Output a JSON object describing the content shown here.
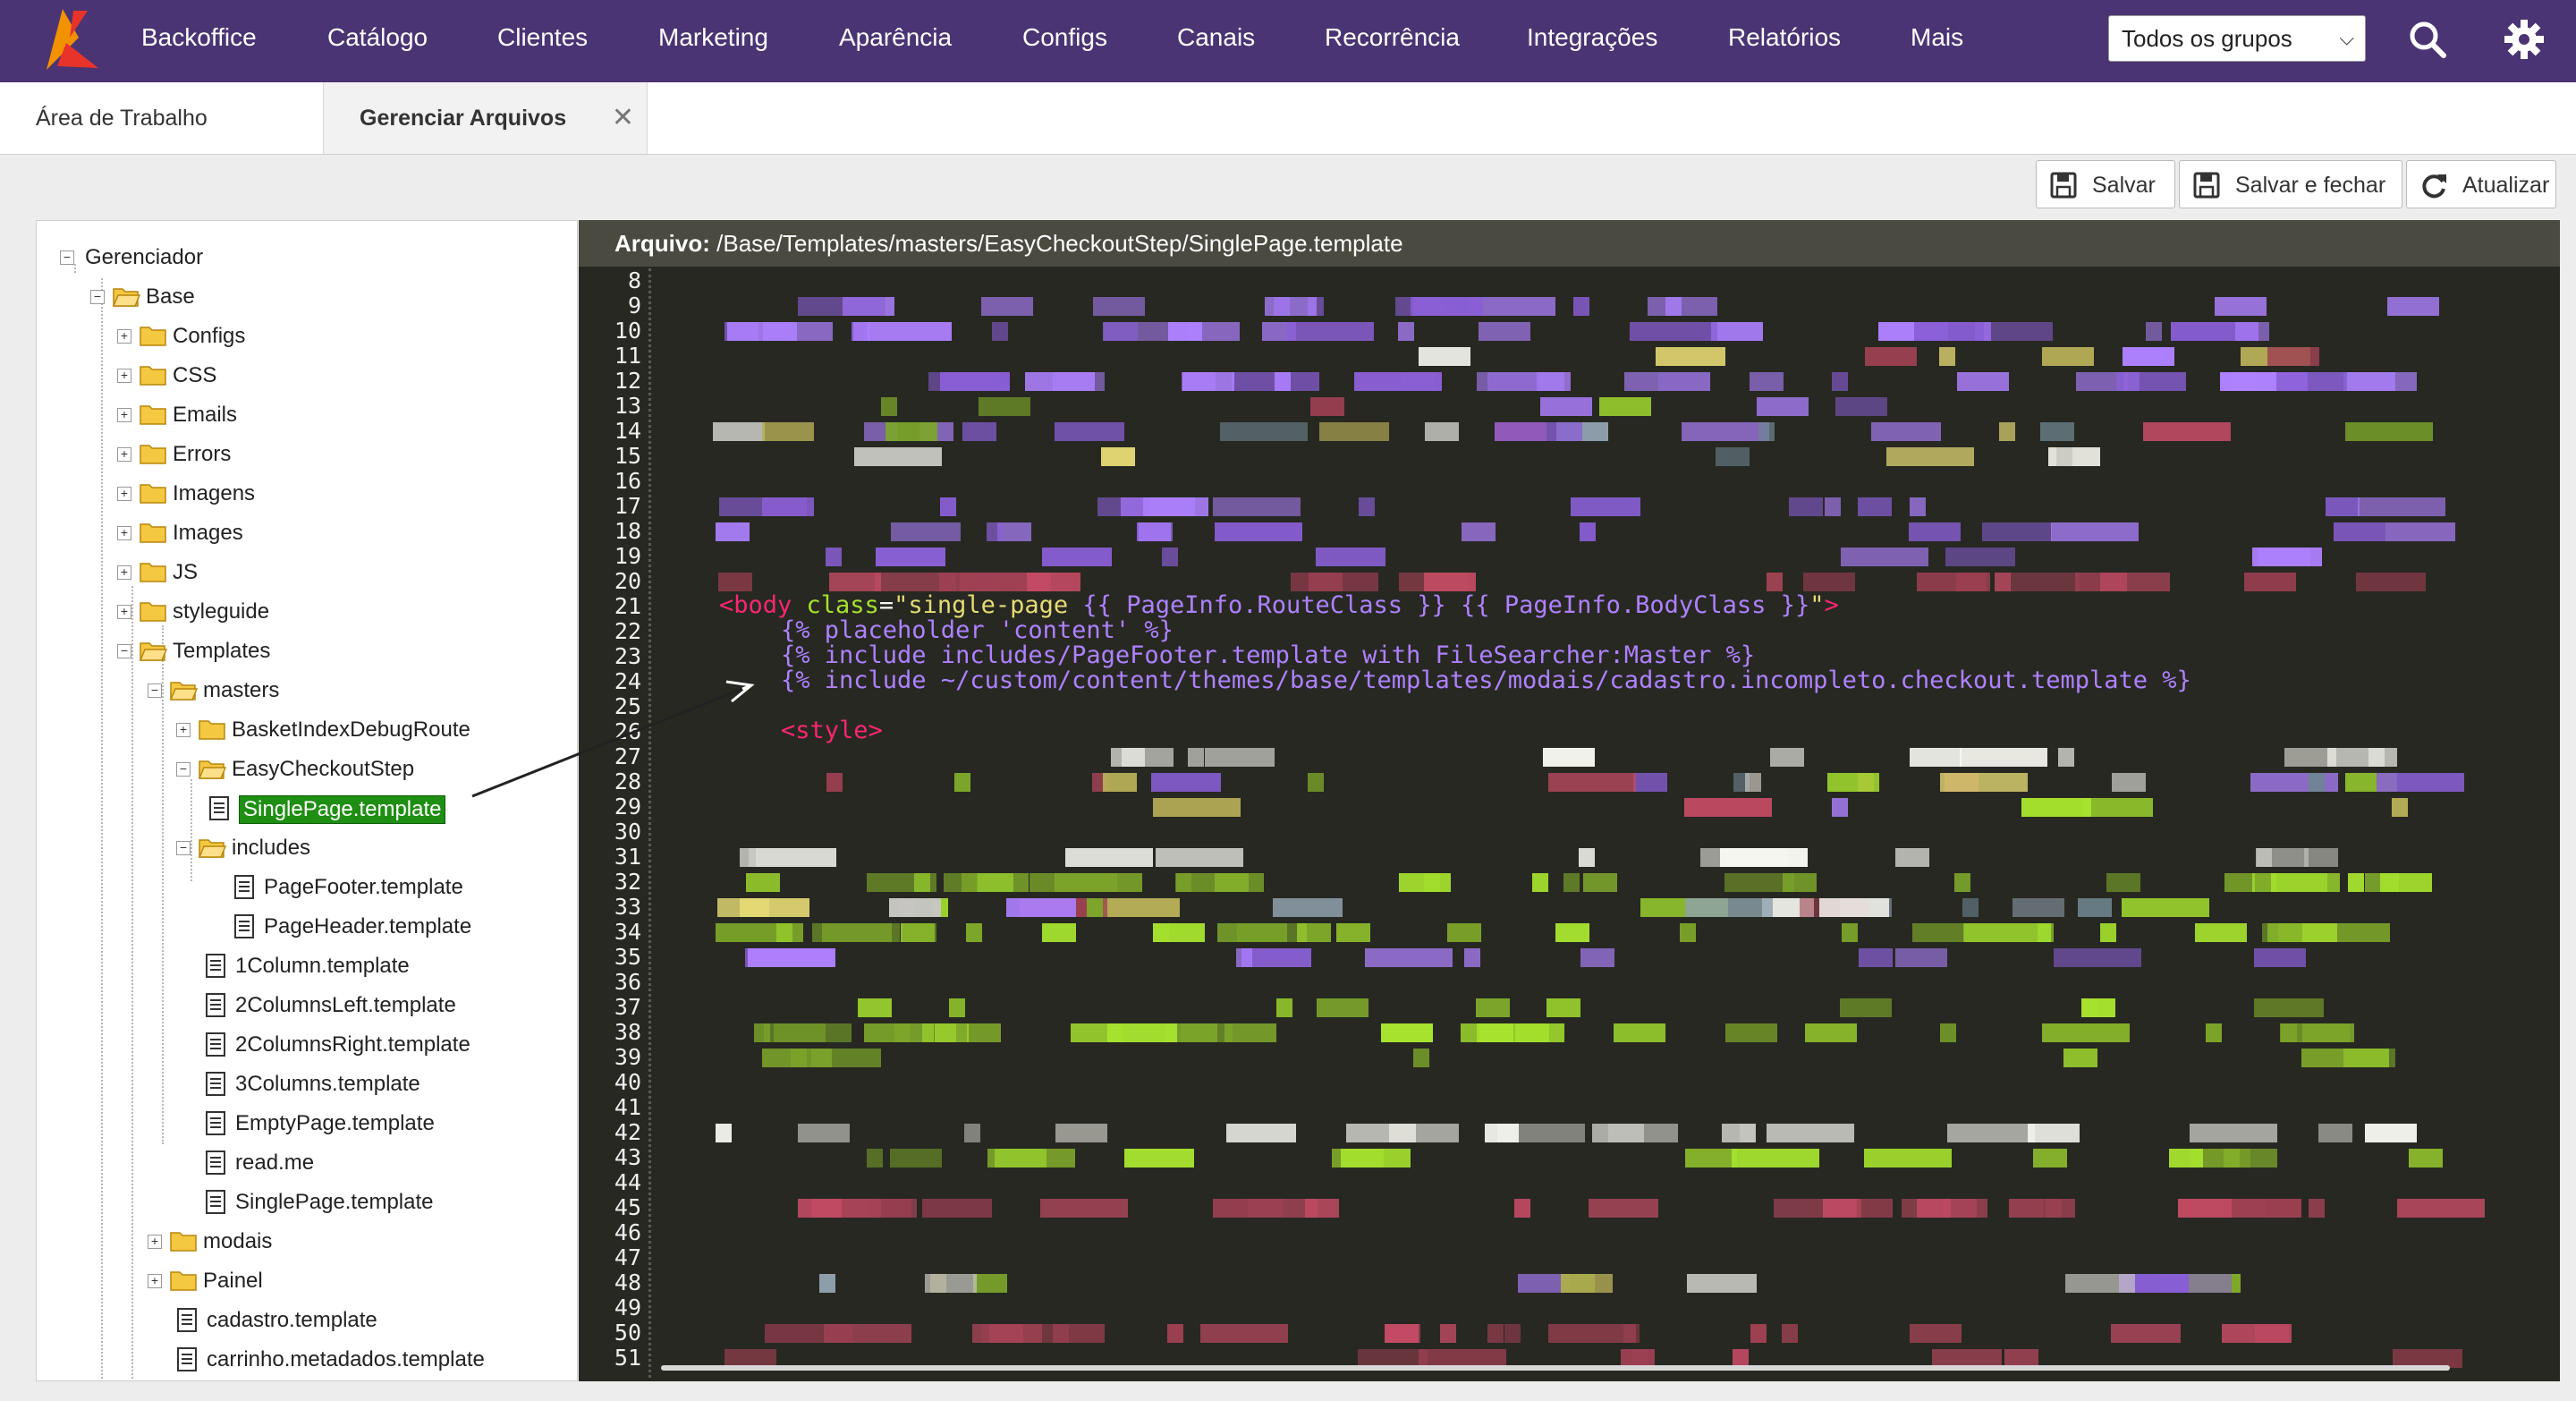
{
  "topnav": {
    "items": [
      "Backoffice",
      "Catálogo",
      "Clientes",
      "Marketing",
      "Aparência",
      "Configs",
      "Canais",
      "Recorrência",
      "Integrações",
      "Relatórios",
      "Mais"
    ],
    "group_select": "Todos os grupos",
    "colors": {
      "bar": "#4a3474",
      "logo_red": "#e8332a",
      "logo_orange": "#f39200"
    }
  },
  "tabs": {
    "workspace": "Área de Trabalho",
    "file_manager": "Gerenciar Arquivos",
    "close_symbol": "✕"
  },
  "toolbar": {
    "save": "Salvar",
    "save_close": "Salvar e fechar",
    "refresh": "Atualizar"
  },
  "tree": {
    "root": "Gerenciador",
    "base": "Base",
    "base_folders": [
      "Configs",
      "CSS",
      "Emails",
      "Errors",
      "Imagens",
      "Images",
      "JS",
      "styleguide"
    ],
    "templates": "Templates",
    "masters": "masters",
    "basket": "BasketIndexDebugRoute",
    "easy": "EasyCheckoutStep",
    "selected_file": "SinglePage.template",
    "includes": "includes",
    "include_files": [
      "PageFooter.template",
      "PageHeader.template"
    ],
    "master_files": [
      "1Column.template",
      "2ColumnsLeft.template",
      "2ColumnsRight.template",
      "3Columns.template",
      "EmptyPage.template",
      "read.me",
      "SinglePage.template"
    ],
    "template_folders": [
      "modais",
      "Painel"
    ],
    "template_files": [
      "cadastro.template",
      "carrinho.metadados.template"
    ]
  },
  "editor": {
    "file_label": "Arquivo:",
    "file_path": "/Base/Templates/masters/EasyCheckoutStep/SinglePage.template",
    "first_line": 8,
    "last_line": 51,
    "code": {
      "l21_tag_open": "<body",
      "l21_attr": " class",
      "l21_eq": "=",
      "l21_quote_open": "\"",
      "l21_class": "single-page",
      "l21_tpl": " {{ PageInfo.RouteClass }} {{ PageInfo.BodyClass }}",
      "l21_quote_close": "\"",
      "l21_tag_close": ">",
      "l22": "{% placeholder 'content' %}",
      "l23": "{% include includes/PageFooter.template with FileSearcher:Master %}",
      "l24": "{% include ~/custom/content/themes/base/templates/modais/cadastro.incompleto.checkout.template %}",
      "l26": "<style>"
    },
    "colors": {
      "background": "#272822",
      "tag": "#f92672",
      "attr": "#a6e22e",
      "string": "#e6db74",
      "template": "#ae81ff"
    }
  }
}
